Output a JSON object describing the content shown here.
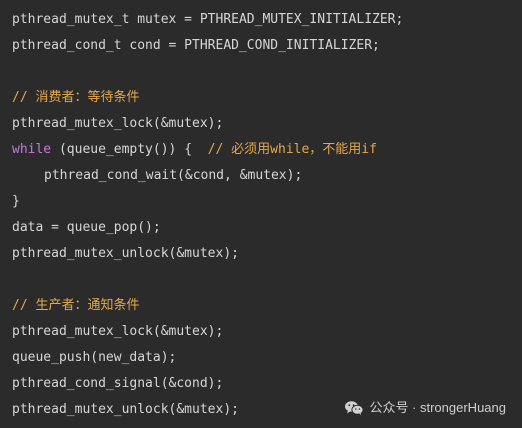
{
  "code": {
    "line1": "pthread_mutex_t mutex = PTHREAD_MUTEX_INITIALIZER;",
    "line2": "pthread_cond_t cond = PTHREAD_COND_INITIALIZER;",
    "consumer_comment": "// 消费者：等待条件",
    "line4": "pthread_mutex_lock(&mutex);",
    "while_keyword": "while",
    "while_rest": " (queue_empty()) {  ",
    "while_comment": "// 必须用while，不能用if",
    "line6": "pthread_cond_wait(&cond, &mutex);",
    "line7": "}",
    "line8": "data = queue_pop();",
    "line9": "pthread_mutex_unlock(&mutex);",
    "producer_comment": "// 生产者：通知条件",
    "line11": "pthread_mutex_lock(&mutex);",
    "line12": "queue_push(new_data);",
    "line13": "pthread_cond_signal(&cond);",
    "line14": "pthread_mutex_unlock(&mutex);"
  },
  "watermark": {
    "text": "公众号 · strongerHuang",
    "icon": "wechat-icon"
  },
  "colors": {
    "background": "#2b2b2b",
    "text": "#d6d6d6",
    "comment": "#e6a84a",
    "keyword": "#c679dd"
  }
}
